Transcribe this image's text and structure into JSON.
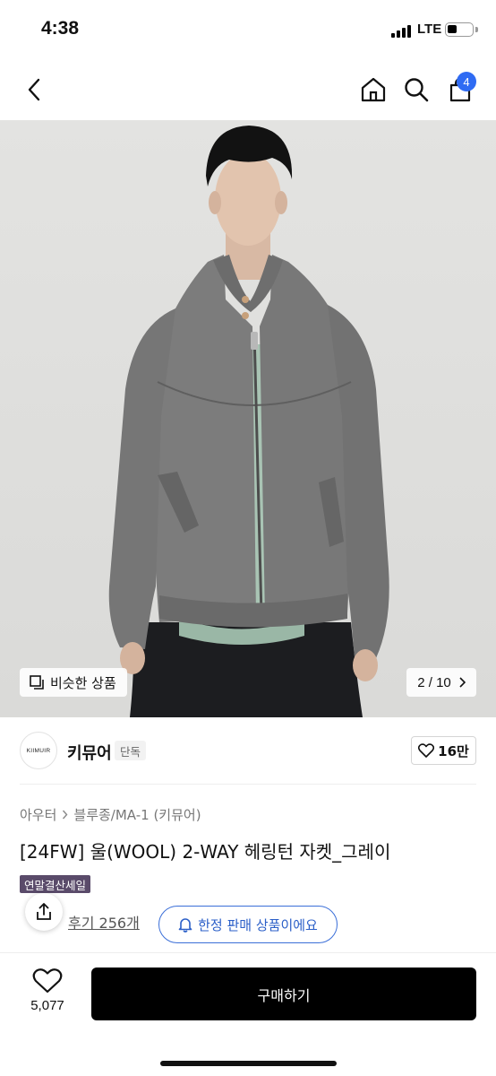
{
  "status_bar": {
    "time": "4:38",
    "network": "LTE"
  },
  "nav": {
    "cart_count": "4"
  },
  "gallery": {
    "similar_label": "비슷한 상품",
    "counter": "2 / 10"
  },
  "brand": {
    "logo_text": "KIIMUIR",
    "name": "키뮤어",
    "tag": "단독",
    "likes": "16만"
  },
  "breadcrumb": {
    "category": "아우터",
    "subcategory": "블루종/MA-1 (키뮤어)"
  },
  "product": {
    "title": "[24FW] 울(WOOL) 2-WAY 헤링턴 자켓_그레이",
    "sale_badge": "연말결산세일",
    "review_link": "후기 256개",
    "limited_label": "한정 판매 상품이에요"
  },
  "bottom": {
    "wish_count": "5,077",
    "buy_label": "구매하기"
  },
  "colors": {
    "accent_blue": "#2f6bf3",
    "sale_badge_bg": "#5a4b6a",
    "buy_button_bg": "#000000"
  }
}
